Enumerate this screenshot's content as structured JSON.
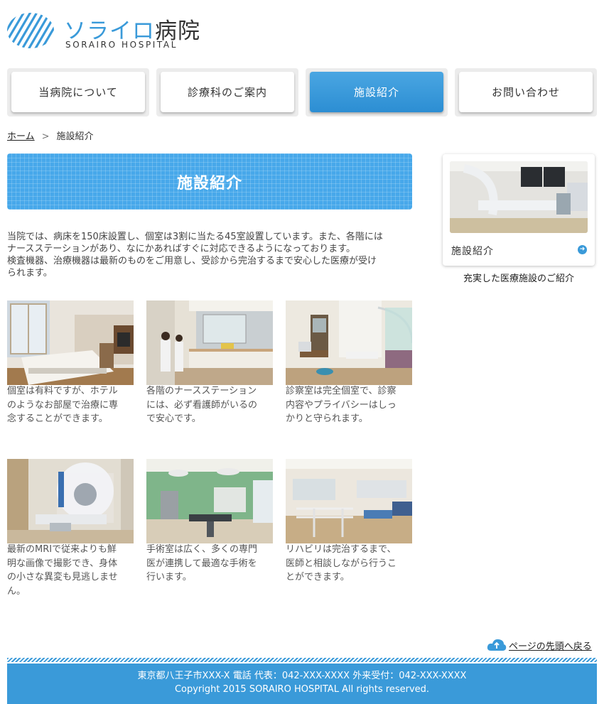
{
  "header": {
    "logo_title_kana": "ソライロ",
    "logo_title_kanji": "病院",
    "logo_subtitle": "SORAIRO HOSPITAL"
  },
  "nav": {
    "items": [
      {
        "label": "当病院について"
      },
      {
        "label": "診療科のご案内"
      },
      {
        "label": "施設紹介"
      },
      {
        "label": "お問い合わせ"
      }
    ],
    "active_index": 2
  },
  "breadcrumb": {
    "home": "ホーム",
    "separator": ">",
    "current": "施設紹介"
  },
  "main": {
    "title": "施設紹介",
    "intro": [
      "当院では、病床を150床設置し、個室は3割に当たる45室設置しています。また、各階には",
      "ナースステーションがあり、なにかあればすぐに対応できるようになっております。",
      "検査機器、治療機器は最新のものをご用意し、受診から完治するまで安心した医療が受け",
      "られます。"
    ],
    "gallery": [
      {
        "photo": "private-room-photo",
        "caption": [
          "個室は有料ですが、ホテル",
          "のようなお部屋で治療に専",
          "念することができます。"
        ]
      },
      {
        "photo": "nurse-station-photo",
        "caption": [
          "各階のナースステーション",
          "には、必ず看護師がいるの",
          "で安心です。"
        ]
      },
      {
        "photo": "exam-room-photo",
        "caption": [
          "診察室は完全個室で、診察",
          "内容やプライバシーはしっ",
          "かりと守られます。"
        ]
      },
      {
        "photo": "mri-photo",
        "caption": [
          "最新のMRIで従来よりも鮮",
          "明な画像で撮影でき、身体",
          "の小さな異変も見逃しませ",
          "ん。"
        ]
      },
      {
        "photo": "operating-room-photo",
        "caption": [
          "手術室は広く、多くの専門",
          "医が連携して最適な手術を",
          "行います。"
        ]
      },
      {
        "photo": "rehab-room-photo",
        "caption": [
          "リハビリは完治するまで、",
          "医師と相談しながら行うこ",
          "とができます。"
        ]
      }
    ]
  },
  "sidebar": {
    "card_label": "施設紹介",
    "card_caption": "充実した医療施設のご紹介"
  },
  "pagetop": {
    "label": "ページの先頭へ戻る"
  },
  "footer": {
    "address": "東京都八王子市XXX-X 電話 代表：042-XXX-XXXX 外来受付：042-XXX-XXXX",
    "copyright": "Copyright 2015 SORAIRO HOSPITAL All rights reserved."
  },
  "colors": {
    "accent": "#3a9ad9",
    "banner": "#47a8ea",
    "text": "#333333"
  }
}
